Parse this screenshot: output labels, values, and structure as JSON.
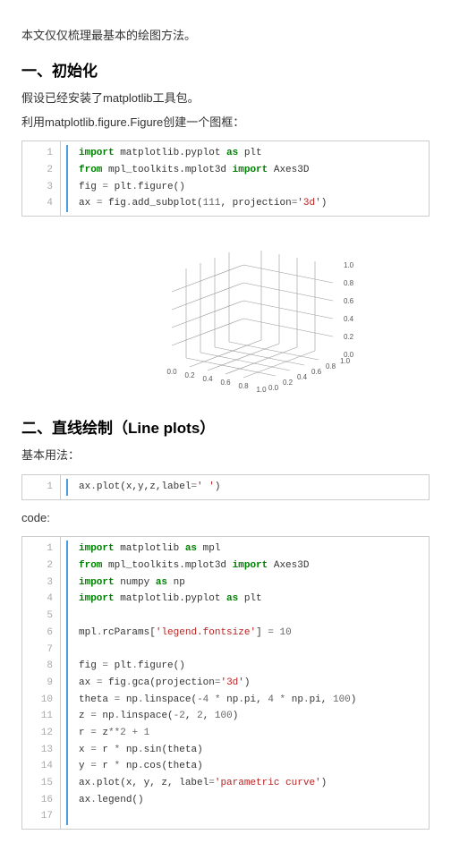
{
  "intro": "本文仅仅梳理最基本的绘图方法。",
  "h1": "一、初始化",
  "p1": "假设已经安装了matplotlib工具包。",
  "p2": "利用matplotlib.figure.Figure创建一个图框：",
  "code1": {
    "lines": [
      [
        [
          "kw",
          "import"
        ],
        [
          "",
          " matplotlib.pyplot "
        ],
        [
          "kw",
          "as"
        ],
        [
          "",
          " plt"
        ]
      ],
      [
        [
          "kw",
          "from"
        ],
        [
          "",
          " mpl_toolkits.mplot3d "
        ],
        [
          "kw",
          "import"
        ],
        [
          "",
          " Axes3D"
        ]
      ],
      [
        [
          "",
          "fig "
        ],
        [
          "op",
          "="
        ],
        [
          "",
          " plt"
        ],
        [
          "op",
          "."
        ],
        [
          "",
          "figure()"
        ]
      ],
      [
        [
          "",
          "ax "
        ],
        [
          "op",
          "="
        ],
        [
          "",
          " fig"
        ],
        [
          "op",
          "."
        ],
        [
          "",
          "add_subplot("
        ],
        [
          "num",
          "111"
        ],
        [
          "",
          ", projection"
        ],
        [
          "op",
          "="
        ],
        [
          "str",
          "'3d'"
        ],
        [
          "",
          ")"
        ]
      ]
    ]
  },
  "chart_data": {
    "type": "3d-axes",
    "x_ticks": [
      0.0,
      0.2,
      0.4,
      0.6,
      0.8,
      1.0
    ],
    "y_ticks": [
      0.0,
      0.2,
      0.4,
      0.6,
      0.8,
      1.0
    ],
    "z_ticks": [
      0.0,
      0.2,
      0.4,
      0.6,
      0.8,
      1.0
    ],
    "xlim": [
      0,
      1
    ],
    "ylim": [
      0,
      1
    ],
    "zlim": [
      0,
      1
    ],
    "title": "",
    "xlabel": "",
    "ylabel": "",
    "zlabel": ""
  },
  "h2": "二、直线绘制（Line plots）",
  "p3": "基本用法：",
  "code2": {
    "lines": [
      [
        [
          "",
          "ax"
        ],
        [
          "op",
          "."
        ],
        [
          "",
          "plot(x,y,z,label"
        ],
        [
          "op",
          "="
        ],
        [
          "str",
          "' '"
        ],
        [
          "",
          ")"
        ]
      ]
    ]
  },
  "p4": "code:",
  "code3": {
    "lines": [
      [
        [
          "kw",
          "import"
        ],
        [
          "",
          " matplotlib "
        ],
        [
          "kw",
          "as"
        ],
        [
          "",
          " mpl"
        ]
      ],
      [
        [
          "kw",
          "from"
        ],
        [
          "",
          " mpl_toolkits.mplot3d "
        ],
        [
          "kw",
          "import"
        ],
        [
          "",
          " Axes3D"
        ]
      ],
      [
        [
          "kw",
          "import"
        ],
        [
          "",
          " numpy "
        ],
        [
          "kw",
          "as"
        ],
        [
          "",
          " np"
        ]
      ],
      [
        [
          "kw",
          "import"
        ],
        [
          "",
          " matplotlib.pyplot "
        ],
        [
          "kw",
          "as"
        ],
        [
          "",
          " plt"
        ]
      ],
      [
        [
          "",
          ""
        ]
      ],
      [
        [
          "",
          "mpl"
        ],
        [
          "op",
          "."
        ],
        [
          "",
          "rcParams["
        ],
        [
          "str",
          "'legend.fontsize'"
        ],
        [
          "",
          "] "
        ],
        [
          "op",
          "="
        ],
        [
          "",
          " "
        ],
        [
          "num",
          "10"
        ]
      ],
      [
        [
          "",
          ""
        ]
      ],
      [
        [
          "",
          "fig "
        ],
        [
          "op",
          "="
        ],
        [
          "",
          " plt"
        ],
        [
          "op",
          "."
        ],
        [
          "",
          "figure()"
        ]
      ],
      [
        [
          "",
          "ax "
        ],
        [
          "op",
          "="
        ],
        [
          "",
          " fig"
        ],
        [
          "op",
          "."
        ],
        [
          "",
          "gca(projection"
        ],
        [
          "op",
          "="
        ],
        [
          "str",
          "'3d'"
        ],
        [
          "",
          ")"
        ]
      ],
      [
        [
          "",
          "theta "
        ],
        [
          "op",
          "="
        ],
        [
          "",
          " np"
        ],
        [
          "op",
          "."
        ],
        [
          "",
          "linspace("
        ],
        [
          "op",
          "-"
        ],
        [
          "num",
          "4"
        ],
        [
          "",
          " "
        ],
        [
          "op",
          "*"
        ],
        [
          "",
          " np"
        ],
        [
          "op",
          "."
        ],
        [
          "",
          "pi, "
        ],
        [
          "num",
          "4"
        ],
        [
          "",
          " "
        ],
        [
          "op",
          "*"
        ],
        [
          "",
          " np"
        ],
        [
          "op",
          "."
        ],
        [
          "",
          "pi, "
        ],
        [
          "num",
          "100"
        ],
        [
          "",
          ")"
        ]
      ],
      [
        [
          "",
          "z "
        ],
        [
          "op",
          "="
        ],
        [
          "",
          " np"
        ],
        [
          "op",
          "."
        ],
        [
          "",
          "linspace("
        ],
        [
          "op",
          "-"
        ],
        [
          "num",
          "2"
        ],
        [
          "",
          ", "
        ],
        [
          "num",
          "2"
        ],
        [
          "",
          ", "
        ],
        [
          "num",
          "100"
        ],
        [
          "",
          ")"
        ]
      ],
      [
        [
          "",
          "r "
        ],
        [
          "op",
          "="
        ],
        [
          "",
          " z"
        ],
        [
          "op",
          "**"
        ],
        [
          "num",
          "2"
        ],
        [
          "",
          " "
        ],
        [
          "op",
          "+"
        ],
        [
          "",
          " "
        ],
        [
          "num",
          "1"
        ]
      ],
      [
        [
          "",
          "x "
        ],
        [
          "op",
          "="
        ],
        [
          "",
          " r "
        ],
        [
          "op",
          "*"
        ],
        [
          "",
          " np"
        ],
        [
          "op",
          "."
        ],
        [
          "",
          "sin(theta)"
        ]
      ],
      [
        [
          "",
          "y "
        ],
        [
          "op",
          "="
        ],
        [
          "",
          " r "
        ],
        [
          "op",
          "*"
        ],
        [
          "",
          " np"
        ],
        [
          "op",
          "."
        ],
        [
          "",
          "cos(theta)"
        ]
      ],
      [
        [
          "",
          "ax"
        ],
        [
          "op",
          "."
        ],
        [
          "",
          "plot(x, y, z, label"
        ],
        [
          "op",
          "="
        ],
        [
          "str",
          "'parametric curve'"
        ],
        [
          "",
          ")"
        ]
      ],
      [
        [
          "",
          "ax"
        ],
        [
          "op",
          "."
        ],
        [
          "",
          "legend()"
        ]
      ],
      [
        [
          "",
          ""
        ]
      ]
    ]
  }
}
